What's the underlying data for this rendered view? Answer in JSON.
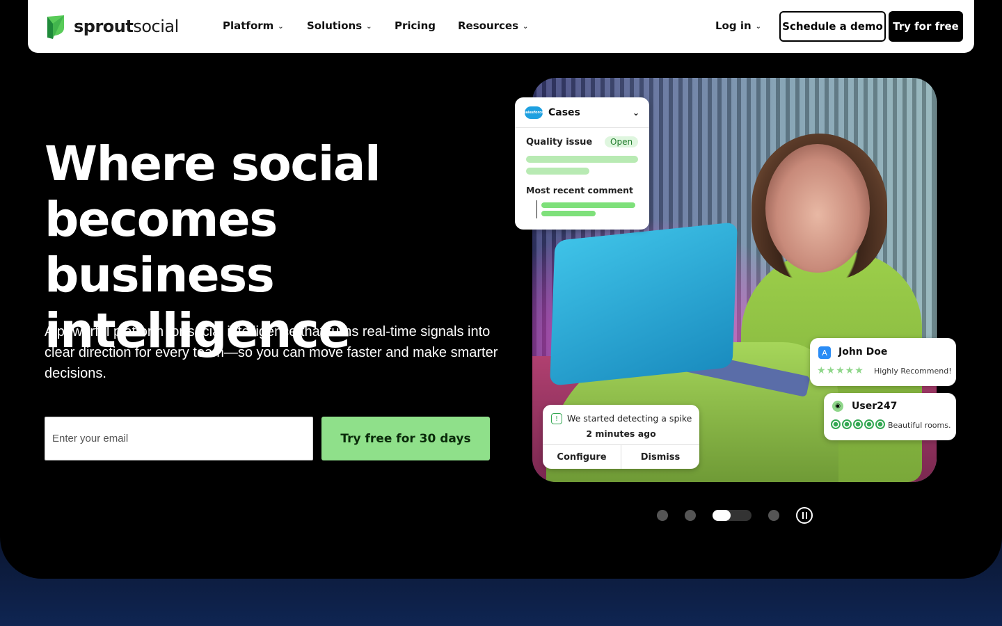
{
  "nav": {
    "logo_prefix": "sprout",
    "logo_suffix": "social",
    "items": [
      {
        "label": "Platform",
        "has_dropdown": true
      },
      {
        "label": "Solutions",
        "has_dropdown": true
      },
      {
        "label": "Pricing",
        "has_dropdown": false
      },
      {
        "label": "Resources",
        "has_dropdown": true
      }
    ],
    "login_label": "Log in",
    "demo_label": "Schedule a demo",
    "try_label": "Try for free"
  },
  "hero": {
    "headline": "Where social becomes business intelligence",
    "subtext": "A powerful platform for social intelligence that turns real-time signals into clear direction for every team—so you can move faster and make smarter decisions.",
    "email_placeholder": "Enter your email",
    "cta_label": "Try free for 30 days"
  },
  "cards": {
    "cases": {
      "title": "Cases",
      "brand_logo_text": "salesforce",
      "issue": "Quality issue",
      "status": "Open",
      "comment_label": "Most recent comment"
    },
    "review_app": {
      "name": "John Doe",
      "rating": 5,
      "stars": "★★★★★",
      "text": "Highly Recommend!"
    },
    "review_travel": {
      "name": "User247",
      "rating": 5,
      "text": "Beautiful rooms."
    },
    "alert": {
      "message": "We started detecting a spike",
      "time": "2 minutes ago",
      "configure_label": "Configure",
      "dismiss_label": "Dismiss"
    }
  },
  "carousel": {
    "total_slides": 4,
    "active_slide": 3
  },
  "colors": {
    "brand_green": "#8fe08a",
    "hero_bg": "#000000",
    "page_bg": "#0a1a36"
  },
  "icons": {
    "chevron": "chevron-down-icon",
    "pause": "pause-icon"
  }
}
